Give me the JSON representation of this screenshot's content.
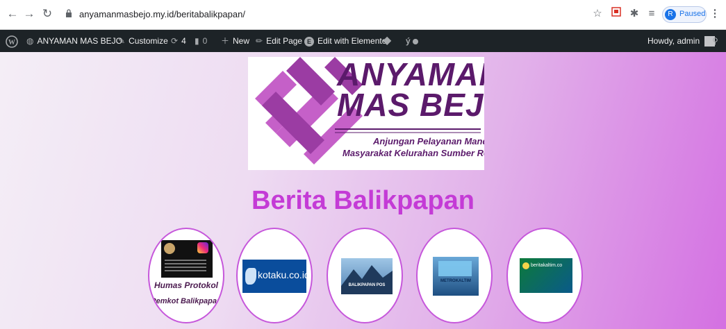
{
  "browser": {
    "url": "anyamanmasbejo.my.id/beritabalikpapan/",
    "profile_initial": "R",
    "profile_status": "Paused"
  },
  "adminbar": {
    "site_name": "ANYAMAN MAS BEJO",
    "customize": "Customize",
    "updates_count": "4",
    "comments_count": "0",
    "new": "New",
    "edit_page": "Edit Page",
    "edit_elementor": "Edit with Elementor",
    "howdy": "Howdy, admin"
  },
  "logo": {
    "line1": "ANYAMAN",
    "line2": "MAS BEJO",
    "tag1": "Anjungan Pelayanan Mandiri",
    "tag2": "Masyarakat Kelurahan Sumber Rejo"
  },
  "page": {
    "title": "Berita Balikpapan"
  },
  "links": [
    {
      "caption1": "Humas Protokol",
      "caption2": "Pemkot Balikpapan"
    },
    {
      "text": "kotaku.co.id"
    },
    {
      "text": "BALIKPAPAN POS"
    },
    {
      "text": "METROKALTIM"
    },
    {
      "text": "beritakaltim.co"
    }
  ],
  "colors": {
    "accent": "#c43bd6",
    "adminbar": "#1d2327",
    "logo_purple": "#5b1a6b"
  }
}
